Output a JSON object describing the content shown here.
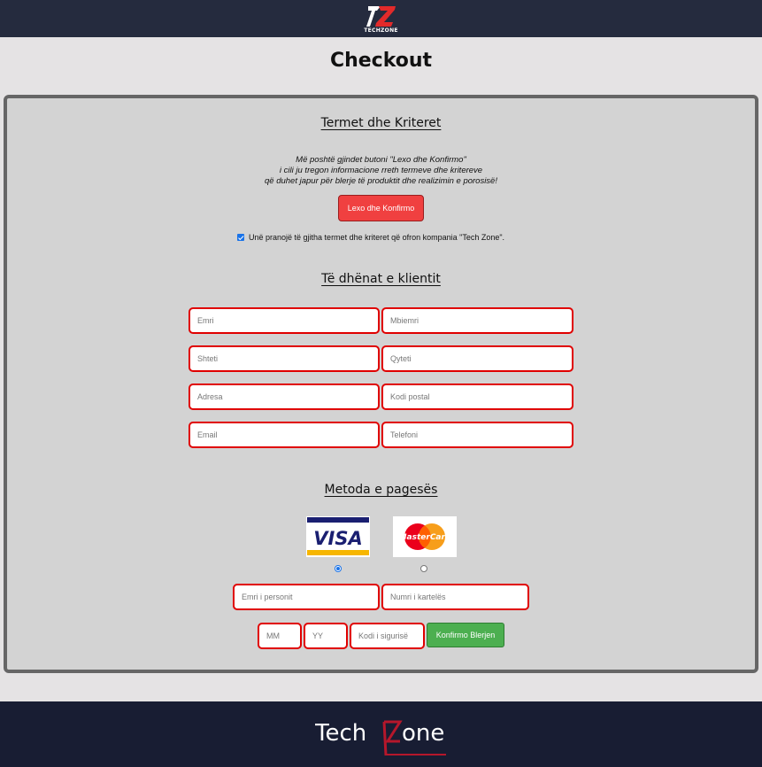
{
  "header": {
    "logo_text": "TECHZONE",
    "logo_mark": "TZ"
  },
  "page_title": "Checkout",
  "terms": {
    "title": "Termet dhe Kriteret",
    "description_lines": [
      "Më poshtë gjindet butoni \"Lexo dhe Konfirmo\"",
      "i cili ju tregon informacione rreth termeve dhe kritereve",
      "që duhet japur për blerje të produktit dhe realizimin e porosisë!"
    ],
    "read_button_label": "Lexo dhe Konfirmo",
    "agree_label": "Unë pranojë të gjitha termet dhe kriteret që ofron kompania \"Tech Zone\".",
    "agree_checked": true
  },
  "client": {
    "title": "Të dhënat e klientit",
    "fields": {
      "first_name_placeholder": "Emri",
      "last_name_placeholder": "Mbiemri",
      "country_placeholder": "Shteti",
      "city_placeholder": "Qyteti",
      "address_placeholder": "Adresa",
      "postal_placeholder": "Kodi postal",
      "email_placeholder": "Email",
      "phone_placeholder": "Telefoni"
    }
  },
  "payment": {
    "title": "Metoda e pagesës",
    "visa_label": "VISA",
    "mastercard_label": "MasterCard",
    "selected_method": "visa",
    "cardholder_placeholder": "Emri i personit",
    "card_number_placeholder": "Numri i kartelës",
    "month_placeholder": "MM",
    "year_placeholder": "YY",
    "cvv_placeholder": "Kodi i sigurisë",
    "confirm_button_label": "Konfirmo Blerjen"
  },
  "footer": {
    "logo_text": "TECHZONE"
  },
  "colors": {
    "header_bg": "#252b3e",
    "footer_bg": "#181d33",
    "accent_red": "#f04040",
    "field_border": "#e00000",
    "confirm_green": "#4caf50"
  }
}
